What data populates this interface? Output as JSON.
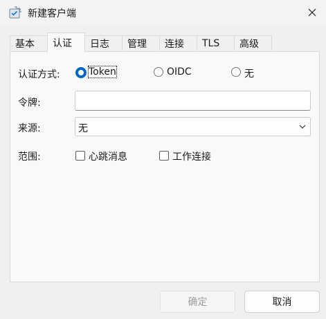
{
  "window": {
    "title": "新建客户端",
    "icon": "client-app-icon"
  },
  "tabs": [
    {
      "label": "基本",
      "active": false
    },
    {
      "label": "认证",
      "active": true
    },
    {
      "label": "日志",
      "active": false
    },
    {
      "label": "管理",
      "active": false
    },
    {
      "label": "连接",
      "active": false
    },
    {
      "label": "TLS",
      "active": false
    },
    {
      "label": "高级",
      "active": false
    }
  ],
  "auth": {
    "method_label": "认证方式:",
    "options": [
      {
        "label": "Token",
        "checked": true
      },
      {
        "label": "OIDC",
        "checked": false
      },
      {
        "label": "无",
        "checked": false
      }
    ],
    "token_label": "令牌:",
    "token_value": "",
    "source_label": "来源:",
    "source_value": "无",
    "scope_label": "范围:",
    "scope_options": [
      {
        "label": "心跳消息",
        "checked": false
      },
      {
        "label": "工作连接",
        "checked": false
      }
    ]
  },
  "buttons": {
    "ok": "确定",
    "cancel": "取消"
  },
  "colors": {
    "accent": "#0067c0",
    "disabled_text": "#9d9d9d"
  }
}
